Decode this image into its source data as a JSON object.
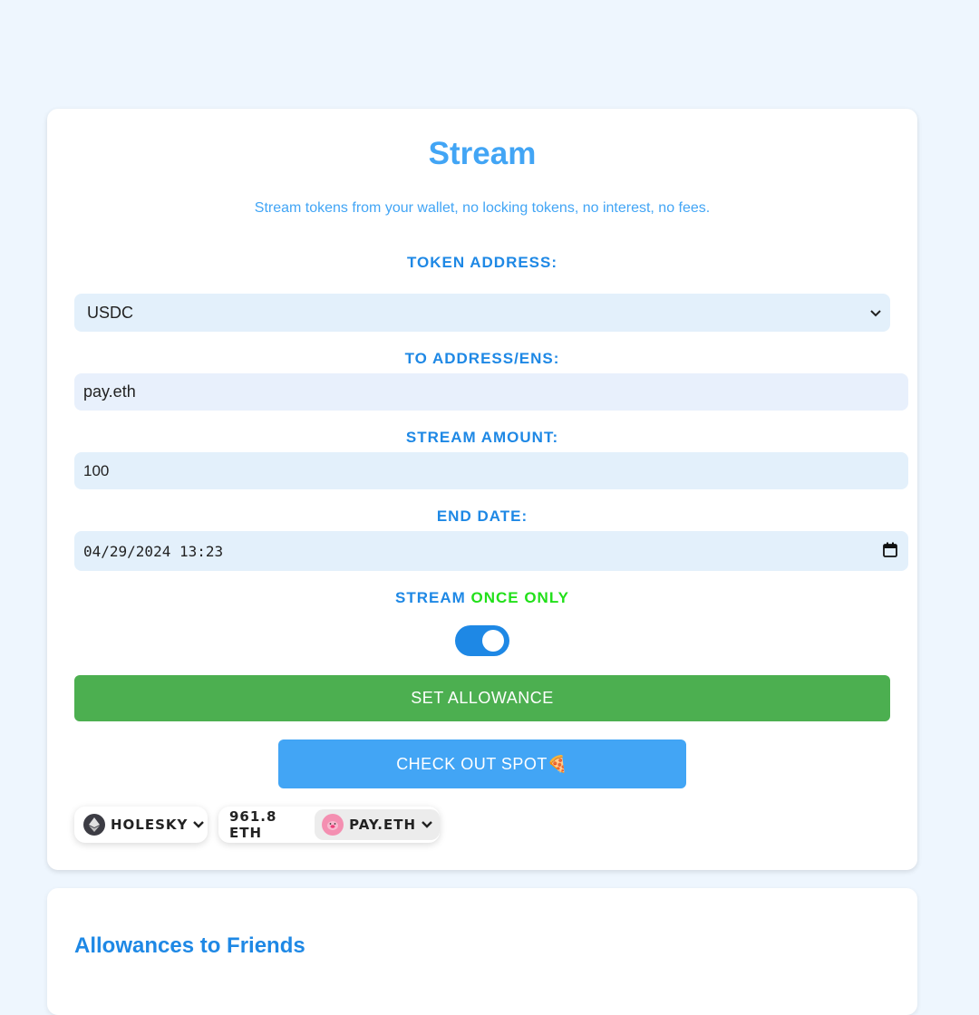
{
  "stream_card": {
    "title": "Stream",
    "subtitle": "Stream tokens from your wallet, no locking tokens, no interest, no fees.",
    "token_label": "TOKEN ADDRESS:",
    "token_value": "USDC",
    "to_label": "TO ADDRESS/ENS:",
    "to_value": "pay.eth",
    "amount_label": "STREAM AMOUNT:",
    "amount_value": "100",
    "end_date_label": "END DATE:",
    "end_date_value": "04/29/2024 13:23",
    "stream_once_prefix": "STREAM",
    "stream_once_highlight": "ONCE ONLY",
    "toggle_on": true,
    "set_allowance_label": "SET ALLOWANCE",
    "check_out_label": "CHECK OUT SPOT",
    "check_out_emoji": "🍕"
  },
  "wallet_bar": {
    "network_label": "HOLESKY",
    "network_icon": "ethereum-icon",
    "balance": "961.8 ETH",
    "account_label": "PAY.ETH",
    "account_avatar": "pig-avatar"
  },
  "allowances_card": {
    "title": "Allowances to Friends"
  },
  "colors": {
    "accent": "#42a5f5",
    "label": "#1e88e5",
    "highlight_green": "#22e01a",
    "allowance_button": "#4caf50",
    "background": "#eef6fe"
  }
}
